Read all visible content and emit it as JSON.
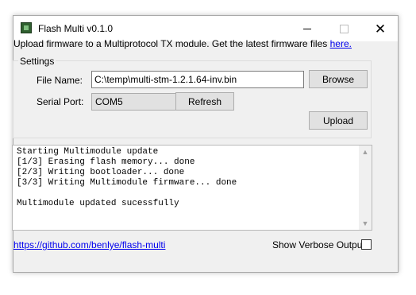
{
  "window": {
    "title": "Flash Multi v0.1.0",
    "icon": "app-icon",
    "controls": {
      "minimize": "minimize-icon",
      "maximize": "maximize-icon",
      "close": "close-icon"
    }
  },
  "intro": {
    "text": "Upload firmware to a Multiprotocol TX module.  Get the latest firmware files ",
    "link": "here."
  },
  "settings": {
    "group_label": "Settings",
    "file_name_label": "File Name:",
    "file_name_value": "C:\\temp\\multi-stm-1.2.1.64-inv.bin",
    "browse_label": "Browse",
    "serial_port_label": "Serial Port:",
    "serial_port_value": "COM5",
    "refresh_label": "Refresh",
    "upload_label": "Upload"
  },
  "log": {
    "text": "Starting Multimodule update\n[1/3] Erasing flash memory... done\n[2/3] Writing bootloader... done\n[3/3] Writing Multimodule firmware... done\n\nMultimodule updated sucessfully"
  },
  "footer": {
    "link": "https://github.com/benlye/flash-multi",
    "verbose_label": "Show Verbose Output:",
    "verbose_checked": false
  }
}
